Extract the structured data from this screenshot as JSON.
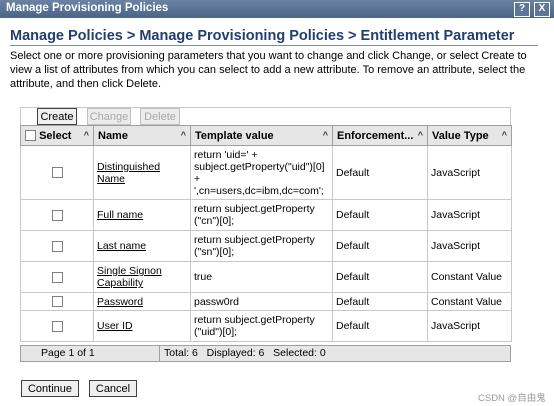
{
  "window": {
    "title": "Manage Provisioning Policies",
    "help_label": "?",
    "close_label": "X"
  },
  "breadcrumb": "Manage Policies > Manage Provisioning Policies > Entitlement Parameter",
  "description": "Select one or more provisioning parameters that you want to change and click Change, or select Create to view a list of attributes from which you can select to add a new attribute. To remove an attribute, select the attribute, and then click Delete.",
  "toolbar": {
    "create_label": "Create",
    "change_label": "Change",
    "delete_label": "Delete"
  },
  "table": {
    "headers": {
      "select": "Select",
      "name": "Name",
      "template": "Template value",
      "enforcement": "Enforcement...",
      "valuetype": "Value Type"
    },
    "rows": [
      {
        "name": "Distinguished Name",
        "template": "return 'uid=' + subject.getProperty(\"uid\")[0] + ',cn=users,dc=ibm,dc=com';",
        "enforcement": "Default",
        "valuetype": "JavaScript"
      },
      {
        "name": "Full name",
        "template": "return subject.getProperty (\"cn\")[0];",
        "enforcement": "Default",
        "valuetype": "JavaScript"
      },
      {
        "name": "Last name",
        "template": "return subject.getProperty (\"sn\")[0];",
        "enforcement": "Default",
        "valuetype": "JavaScript"
      },
      {
        "name": "Single Signon Capability",
        "template": "true",
        "enforcement": "Default",
        "valuetype": "Constant Value"
      },
      {
        "name": "Password",
        "template": "passw0rd",
        "enforcement": "Default",
        "valuetype": "Constant Value"
      },
      {
        "name": "User ID",
        "template": "return subject.getProperty (\"uid\")[0];",
        "enforcement": "Default",
        "valuetype": "JavaScript"
      }
    ]
  },
  "footer": {
    "page": "Page 1 of 1",
    "status": "Total: 6   Displayed: 6   Selected: 0"
  },
  "actions": {
    "continue_label": "Continue",
    "cancel_label": "Cancel"
  },
  "watermark": "CSDN @自由鬼"
}
